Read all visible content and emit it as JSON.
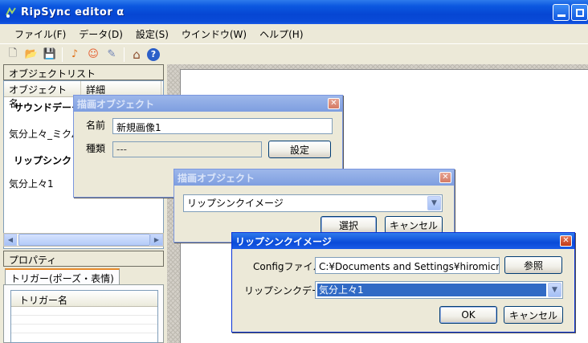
{
  "window": {
    "title": "RipSync editor α"
  },
  "menu": [
    "ファイル(F)",
    "データ(D)",
    "設定(S)",
    "ウインドウ(W)",
    "ヘルプ(H)"
  ],
  "toolbar": [
    {
      "name": "new-file-icon",
      "glyph": "🗋"
    },
    {
      "name": "open-folder-icon",
      "glyph": "📂"
    },
    {
      "name": "save-icon",
      "glyph": "💾"
    },
    {
      "name": "music-note-icon",
      "glyph": "♪"
    },
    {
      "name": "face-icon",
      "glyph": "☺"
    },
    {
      "name": "broom-icon",
      "glyph": "✎"
    },
    {
      "name": "home-icon",
      "glyph": "⌂"
    },
    {
      "name": "help-icon",
      "glyph": "?"
    }
  ],
  "left": {
    "object_list_header": "オブジェクトリスト",
    "columns": [
      "オブジェクト名",
      "詳細"
    ],
    "sound_group": "サウンドデータ",
    "sound_item": "気分上々_ミクパ",
    "lipsync_group": "リップシンク デ",
    "lipsync_item": "気分上々1",
    "property_header": "プロパティ",
    "tab_label": "トリガー(ポーズ・表情)",
    "trigger_column": "トリガー名"
  },
  "dialog1": {
    "title": "描画オブジェクト",
    "name_label": "名前",
    "name_value": "新規画像1",
    "type_label": "種類",
    "type_value": "---",
    "settings_button": "設定"
  },
  "dialog2": {
    "title": "描画オブジェクト",
    "combo_value": "リップシンクイメージ",
    "select_button": "選択",
    "cancel_button": "キャンセル"
  },
  "dialog3": {
    "title": "リップシンクイメージ",
    "config_label": "Configファイル",
    "config_value": "C:¥Documents and Settings¥hiromicm¥デスク",
    "browse_button": "参照",
    "lipsync_label": "リップシンクデータ",
    "lipsync_value": "気分上々1",
    "ok_button": "OK",
    "cancel_button": "キャンセル"
  },
  "colors": {
    "titlebar": "#0a4bd8",
    "selection": "#316ac5",
    "close_button": "#c13a18"
  }
}
